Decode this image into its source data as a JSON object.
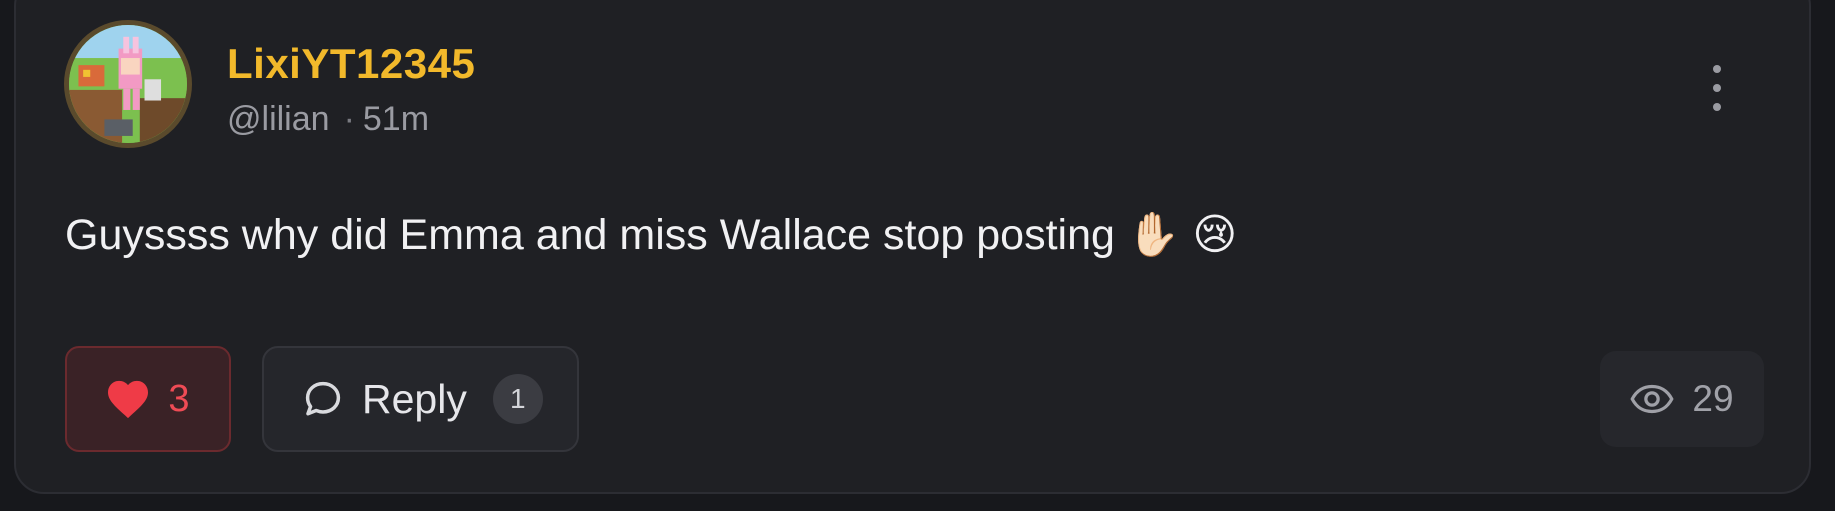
{
  "post": {
    "username": "LixiYT12345",
    "handle": "@lilian",
    "separator": "·",
    "time_ago": "51m",
    "text": "Guyssss why did Emma and miss Wallace stop posting ✋🏻 😢"
  },
  "actions": {
    "like_count": "3",
    "reply_label": "Reply",
    "reply_count": "1",
    "view_count": "29",
    "liked": true
  },
  "colors": {
    "username": "#f2b92b",
    "like_accent": "#ef4b55",
    "card_bg": "#1f2024",
    "page_bg": "#17181c"
  },
  "icons": {
    "avatar": "avatar-image",
    "more": "more-vertical-icon",
    "like": "heart-icon",
    "reply": "speech-bubble-icon",
    "views": "eye-icon"
  }
}
